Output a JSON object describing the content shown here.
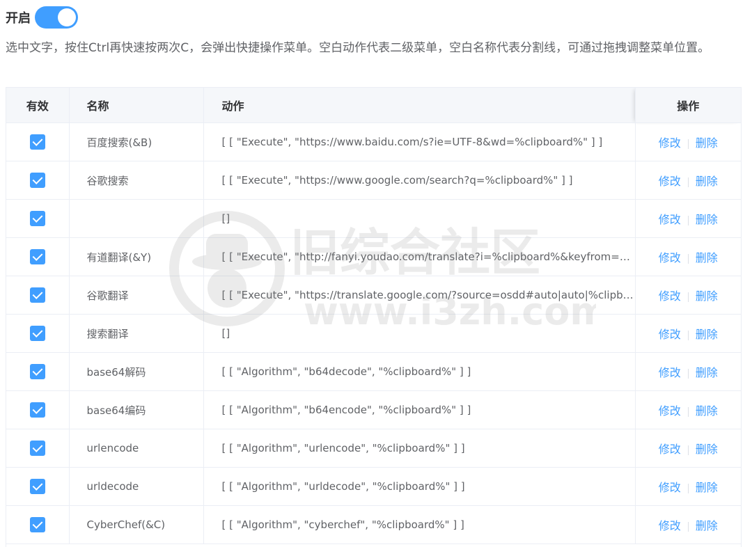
{
  "header": {
    "label": "开启",
    "enabled": true
  },
  "description": "选中文字，按住Ctrl再快速按两次C，会弹出快捷操作菜单。空白动作代表二级菜单，空白名称代表分割线，可通过拖拽调整菜单位置。",
  "table": {
    "columns": {
      "valid": "有效",
      "name": "名称",
      "action": "动作",
      "operation": "操作"
    },
    "rows": [
      {
        "checked": true,
        "name": "百度搜索(&B)",
        "action": "[ [ \"Execute\", \"https://www.baidu.com/s?ie=UTF-8&wd=%clipboard%\" ] ]",
        "edit": "修改",
        "delete": "删除"
      },
      {
        "checked": true,
        "name": "谷歌搜索",
        "action": "[ [ \"Execute\", \"https://www.google.com/search?q=%clipboard%\" ] ]",
        "edit": "修改",
        "delete": "删除"
      },
      {
        "checked": true,
        "name": "",
        "action": "[]",
        "edit": "修改",
        "delete": "删除"
      },
      {
        "checked": true,
        "name": "有道翻译(&Y)",
        "action": "[ [ \"Execute\", \"http://fanyi.youdao.com/translate?i=%clipboard%&keyfrom=p…",
        "edit": "修改",
        "delete": "删除"
      },
      {
        "checked": true,
        "name": "谷歌翻译",
        "action": "[ [ \"Execute\", \"https://translate.google.com/?source=osdd#auto|auto|%clipb…",
        "edit": "修改",
        "delete": "删除"
      },
      {
        "checked": true,
        "name": "搜索翻译",
        "action": "[]",
        "edit": "修改",
        "delete": "删除"
      },
      {
        "checked": true,
        "name": "base64解码",
        "action": "[ [ \"Algorithm\", \"b64decode\", \"%clipboard%\" ] ]",
        "edit": "修改",
        "delete": "删除"
      },
      {
        "checked": true,
        "name": "base64编码",
        "action": "[ [ \"Algorithm\", \"b64encode\", \"%clipboard%\" ] ]",
        "edit": "修改",
        "delete": "删除"
      },
      {
        "checked": true,
        "name": "urlencode",
        "action": "[ [ \"Algorithm\", \"urlencode\", \"%clipboard%\" ] ]",
        "edit": "修改",
        "delete": "删除"
      },
      {
        "checked": true,
        "name": "urldecode",
        "action": "[ [ \"Algorithm\", \"urldecode\", \"%clipboard%\" ] ]",
        "edit": "修改",
        "delete": "删除"
      },
      {
        "checked": true,
        "name": "CyberChef(&C)",
        "action": "[ [ \"Algorithm\", \"cyberchef\", \"%clipboard%\" ] ]",
        "edit": "修改",
        "delete": "删除"
      }
    ]
  },
  "watermark": {
    "title": "旧综合社区",
    "url": "www.i3zh.com"
  },
  "colors": {
    "accent": "#409eff",
    "header_bg": "#f5f7fa",
    "border": "#ebeef5"
  }
}
